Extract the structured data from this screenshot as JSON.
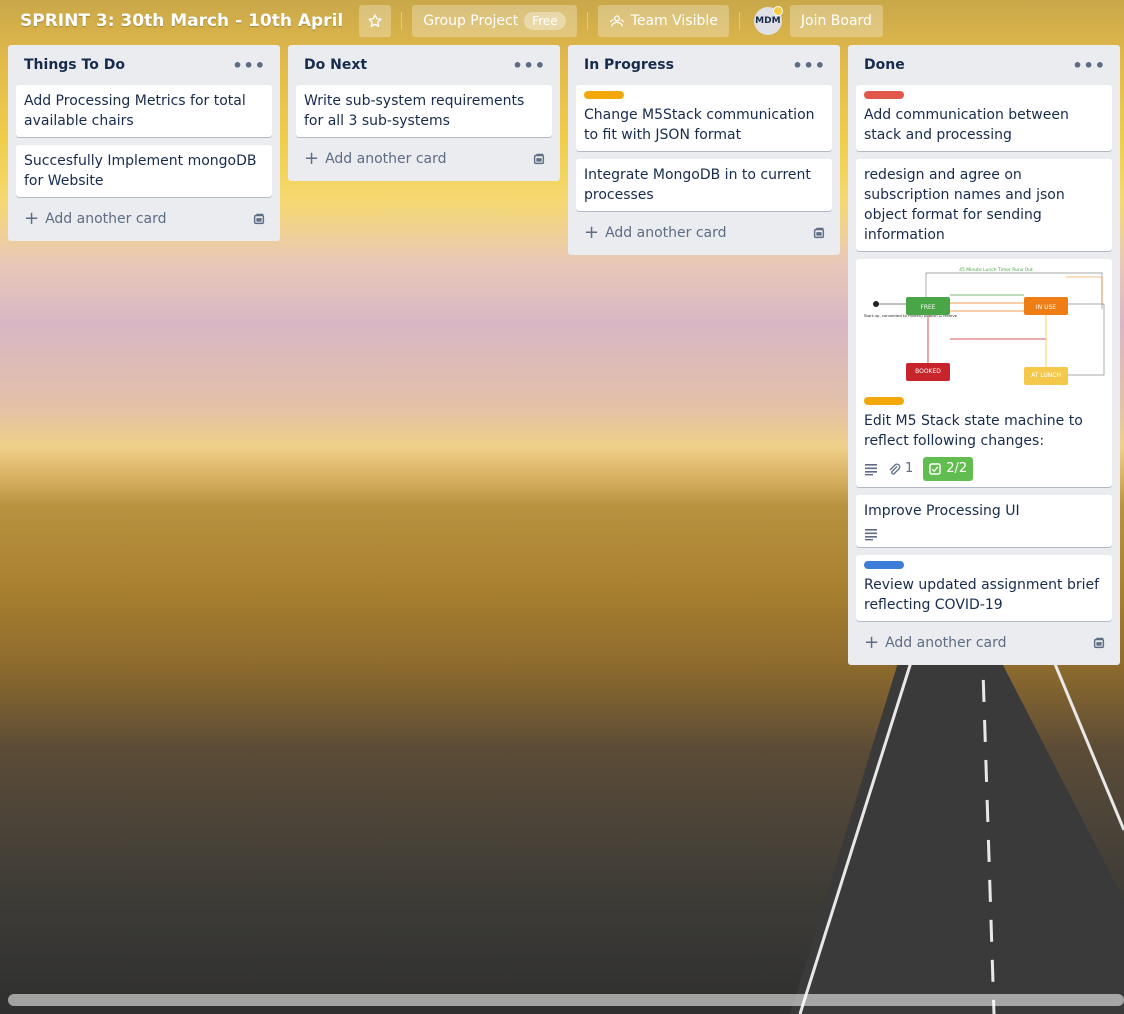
{
  "header": {
    "title": "SPRINT 3: 30th March - 10th April",
    "team_label": "Group Project",
    "free_badge": "Free",
    "visibility_label": "Team Visible",
    "avatar_initials": "MDM",
    "join_label": "Join Board"
  },
  "lists": [
    {
      "title": "Things To Do",
      "cards": [
        {
          "text": "Add Processing Metrics for total available chairs"
        },
        {
          "text": "Succesfully Implement mongoDB for Website"
        }
      ],
      "add_label": "Add another card"
    },
    {
      "title": "Do Next",
      "cards": [
        {
          "text": "Write sub-system requirements for all 3 sub-systems"
        }
      ],
      "add_label": "Add another card"
    },
    {
      "title": "In Progress",
      "cards": [
        {
          "text": "Change M5Stack communication to fit with JSON format",
          "label_color": "#f2a70a"
        },
        {
          "text": "Integrate MongoDB in to current processes"
        }
      ],
      "add_label": "Add another card"
    },
    {
      "title": "Done",
      "cards": [
        {
          "text": "Add communication between stack and processing",
          "label_color": "#e2574c"
        },
        {
          "text": "redesign and agree on subscription names and json object format for sending information"
        },
        {
          "text": "Edit M5 Stack state machine to reflect following changes:",
          "label_color": "#f2a70a",
          "attachments": "1",
          "checklist": "2/2"
        },
        {
          "text": "Improve Processing UI"
        },
        {
          "text": "Review updated assignment brief reflecting COVID-19",
          "label_color": "#3b7dd8"
        }
      ],
      "add_label": "Add another card"
    }
  ],
  "diagram": {
    "free": "FREE",
    "in_use": "IN USE",
    "booked": "BOOKED",
    "at_lunch": "AT LUNCH",
    "start_text": "Start-up, connected to HiveMQ publish & receive",
    "top_text": "45 Minute Lunch Timer Runs Out",
    "colors": {
      "free": "#4aa546",
      "in_use": "#ef7d16",
      "booked": "#c8242b",
      "at_lunch": "#f3c84b"
    }
  }
}
